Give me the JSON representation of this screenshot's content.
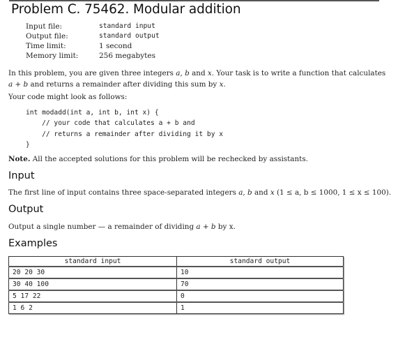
{
  "problem": {
    "title": "Problem C. 75462. Modular addition"
  },
  "meta": [
    {
      "label": "Input file:",
      "value": "standard input",
      "mono": true
    },
    {
      "label": "Output file:",
      "value": "standard output",
      "mono": true
    },
    {
      "label": "Time limit:",
      "value": "1 second",
      "mono": false
    },
    {
      "label": "Memory limit:",
      "value": "256 megabytes",
      "mono": false
    }
  ],
  "statement": {
    "line1_pre": "In this problem, you are given three integers ",
    "line1_a": "a",
    "line1_sep1": ", ",
    "line1_b": "b",
    "line1_and": " and ",
    "line1_x": "x",
    "line1_post": ". Your task is to write a function that calculates",
    "line2_expr": "a + b",
    "line2_mid": " and returns a remainder after dividing this sum by ",
    "line2_x": "x",
    "line2_post": ".",
    "line3": "Your code might look as follows:"
  },
  "code": "int modadd(int a, int b, int x) {\n    // your code that calculates a + b and\n    // returns a remainder after dividing it by x\n}",
  "note": {
    "label": "Note.",
    "text": " All the accepted solutions for this problem will be rechecked by assistants."
  },
  "input_section": {
    "heading": "Input",
    "text_pre": "The first line of input contains three space-separated integers ",
    "text_math": "a, b",
    "text_and": " and ",
    "text_x": "x",
    "text_constraints": " (1 ≤ a, b ≤ 1000, 1 ≤ x ≤ 100)."
  },
  "output_section": {
    "heading": "Output",
    "text_pre": "Output a single number — a remainder of dividing ",
    "text_math": "a + b",
    "text_post": " by x."
  },
  "examples": {
    "heading": "Examples",
    "headers": [
      "standard input",
      "standard output"
    ],
    "rows": [
      {
        "input": "20 20 30",
        "output": "10"
      },
      {
        "input": "30 40 100",
        "output": "70"
      },
      {
        "input": "5 17 22",
        "output": "0"
      },
      {
        "input": "1 6 2",
        "output": "1"
      }
    ]
  }
}
